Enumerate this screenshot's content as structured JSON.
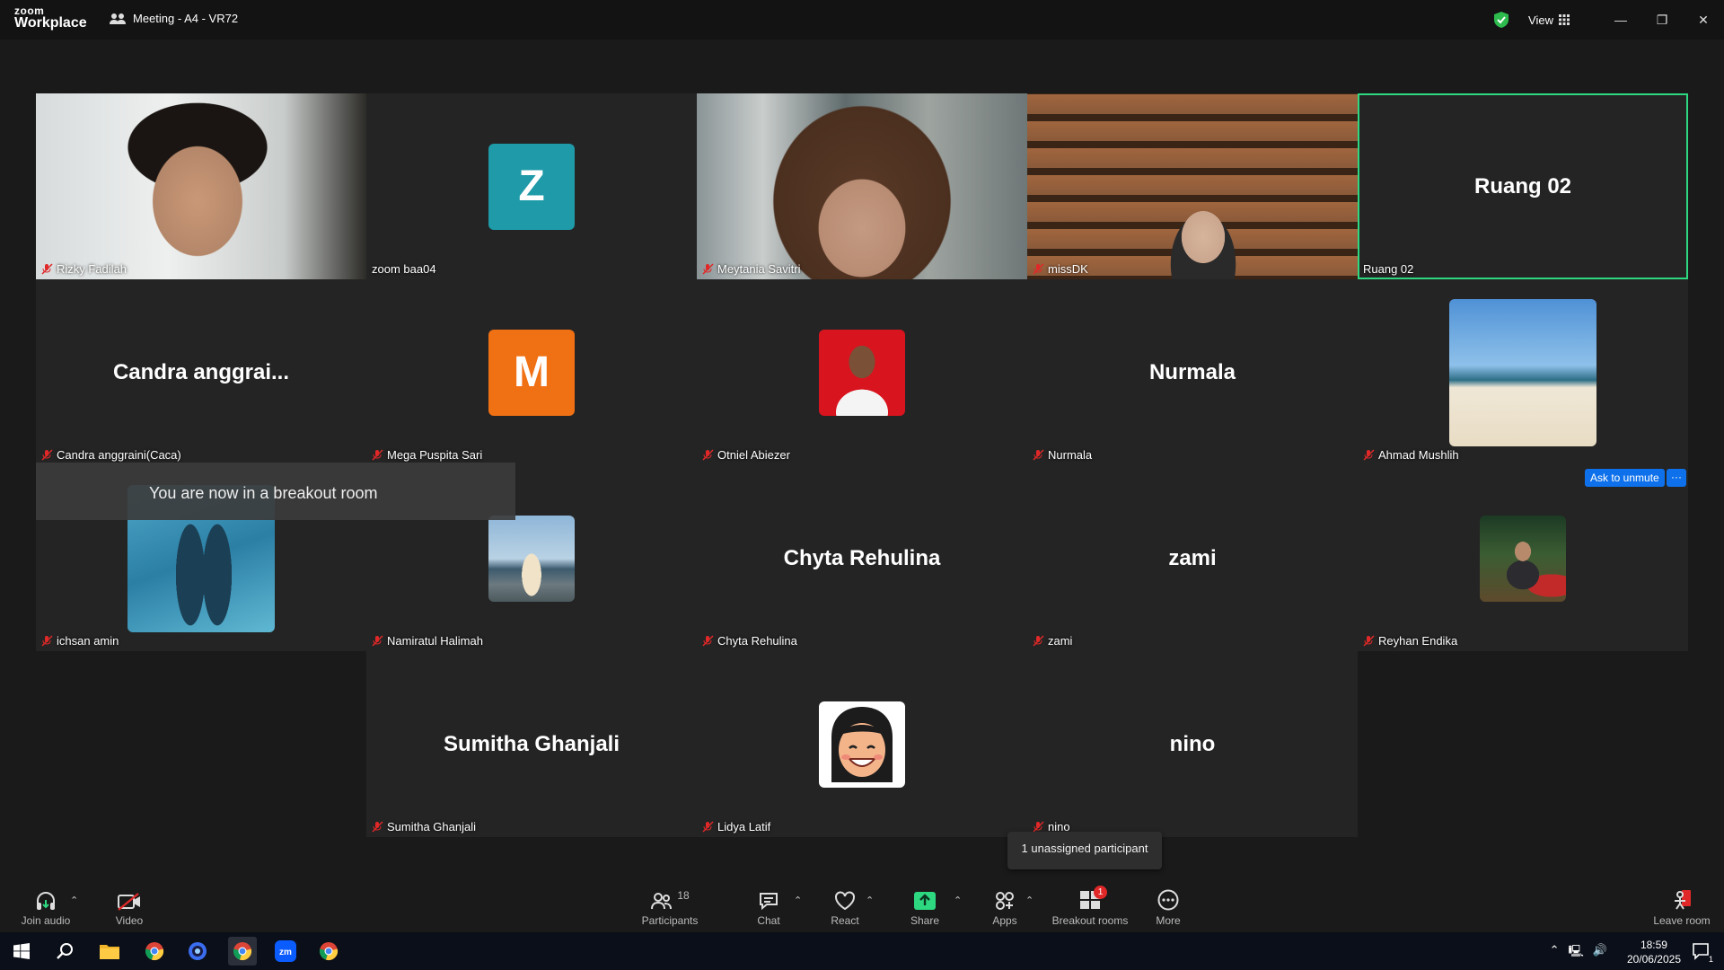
{
  "app": {
    "logo_top": "zoom",
    "logo_bottom": "Workplace",
    "meeting_title": "Meeting - A4 - VR72",
    "view_label": "View"
  },
  "tiles": [
    {
      "name": "Rizky Fadilah",
      "type": "video"
    },
    {
      "name": "zoom baa04",
      "type": "letter",
      "letter": "Z",
      "color": "#1e9aa8"
    },
    {
      "name": "Meytania Savitri",
      "type": "video"
    },
    {
      "name": "missDK",
      "type": "video"
    },
    {
      "name": "Ruang 02",
      "type": "bigname",
      "display": "Ruang 02",
      "active": true
    },
    {
      "name": "Candra anggraini(Caca)",
      "type": "bigname",
      "display": "Candra  anggrai..."
    },
    {
      "name": "Mega Puspita Sari",
      "type": "letter",
      "letter": "M",
      "color": "#f07014"
    },
    {
      "name": "Otniel Abiezer",
      "type": "photo"
    },
    {
      "name": "Nurmala",
      "type": "bigname",
      "display": "Nurmala"
    },
    {
      "name": "Ahmad Mushlih",
      "type": "photo"
    },
    {
      "name": "ichsan amin",
      "type": "photo"
    },
    {
      "name": "Namiratul Halimah",
      "type": "photo"
    },
    {
      "name": "Chyta Rehulina",
      "type": "bigname",
      "display": "Chyta Rehulina"
    },
    {
      "name": "zami",
      "type": "bigname",
      "display": "zami"
    },
    {
      "name": "Reyhan Endika",
      "type": "photo"
    },
    {
      "name": "Sumitha Ghanjali",
      "type": "bigname",
      "display": "Sumitha Ghanjali"
    },
    {
      "name": "Lidya Latif",
      "type": "photo"
    },
    {
      "name": "nino",
      "type": "bigname",
      "display": "nino"
    }
  ],
  "toast": "You are now in a breakout room",
  "ask_unmute": "Ask to unmute",
  "more_dots": "···",
  "tooltip": "1 unassigned participant",
  "toolbar": {
    "join_audio": "Join audio",
    "video": "Video",
    "participants": "Participants",
    "participants_count": "18",
    "chat": "Chat",
    "react": "React",
    "share": "Share",
    "apps": "Apps",
    "breakout_rooms": "Breakout rooms",
    "breakout_badge": "1",
    "more": "More",
    "leave_room": "Leave room"
  },
  "taskbar": {
    "time": "18:59",
    "date": "20/06/2025",
    "notif_count": "1"
  },
  "colors": {
    "accent_green": "#2dd880",
    "zoom_blue": "#0e71eb",
    "mute_red": "#e02828"
  }
}
